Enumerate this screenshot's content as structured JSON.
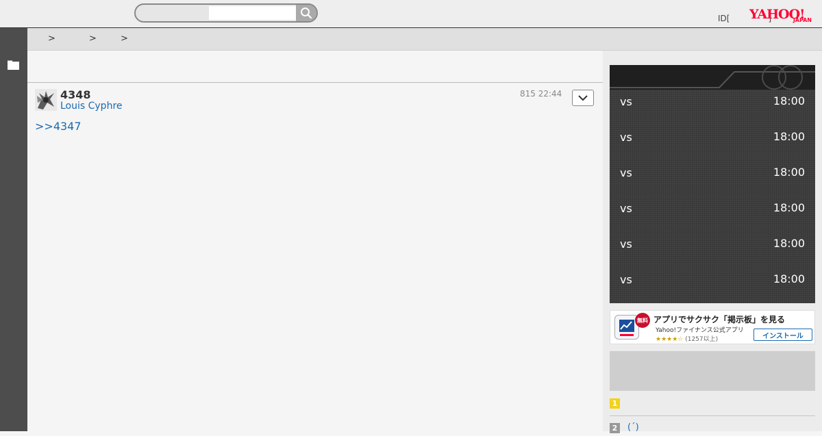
{
  "header": {
    "search": {
      "placeholder": "",
      "value": ""
    },
    "user_id_prefix": "ID[",
    "user_id_suffix": "]",
    "logo_main": "YAHOO!",
    "logo_sub": "JAPAN"
  },
  "breadcrumb": {
    "items": [
      ">",
      ">",
      ">"
    ]
  },
  "post": {
    "number": "4348",
    "author": "Louis Cyphre",
    "timestamp": "815 22:44",
    "body_link": ">>4347"
  },
  "sidebar": {
    "games": [
      {
        "vs": "vs",
        "time": "18:00"
      },
      {
        "vs": "vs",
        "time": "18:00"
      },
      {
        "vs": "vs",
        "time": "18:00"
      },
      {
        "vs": "vs",
        "time": "18:00"
      },
      {
        "vs": "vs",
        "time": "18:00"
      },
      {
        "vs": "vs",
        "time": "18:00"
      }
    ],
    "app_banner": {
      "badge": "無料",
      "title": "アプリでサクサク「掲示板」を見る",
      "subtitle": "Yahoo!ファイナンス公式アプリ",
      "stars": "★★★★☆",
      "rating_count": "(1257以上)",
      "install_label": "インストール"
    },
    "ranking": [
      {
        "rank": "1",
        "text": "",
        "badge_color": "#f2d21c"
      },
      {
        "rank": "2",
        "text": "(´)",
        "badge_color": "#999999"
      }
    ]
  },
  "colors": {
    "link": "#1a6ab0",
    "brand": "#ff0033",
    "rail": "#4d4d4d"
  }
}
